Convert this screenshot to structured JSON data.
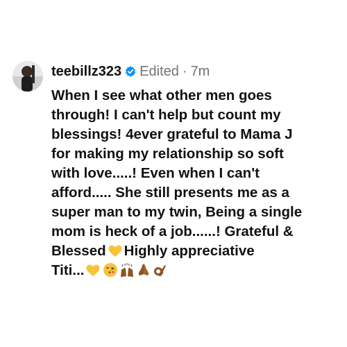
{
  "comment": {
    "username": "teebillz323",
    "status": "Edited",
    "separator": "·",
    "time": "7m",
    "text_before_heart": "When I see what other men goes\nthrough! I can't help but count my\nblessings! 4ever grateful to Mama J\nfor making my relationship so soft\nwith love.....! Even when I can't\nafford..... She still presents me as a\nsuper man to my twin, Being a single\nmom is heck of a job......! Grateful &\nBlessed",
    "text_after_heart": "Highly appreciative\nTiti...",
    "emojis": [
      "yellow-heart-icon",
      "face-blowing-kiss-icon",
      "raising-hands-icon",
      "folded-hands-icon",
      "ok-hand-icon"
    ],
    "colors": {
      "text": "#111111",
      "meta": "#737373",
      "verified": "#0095f6",
      "heart": "#f8c33b"
    }
  }
}
